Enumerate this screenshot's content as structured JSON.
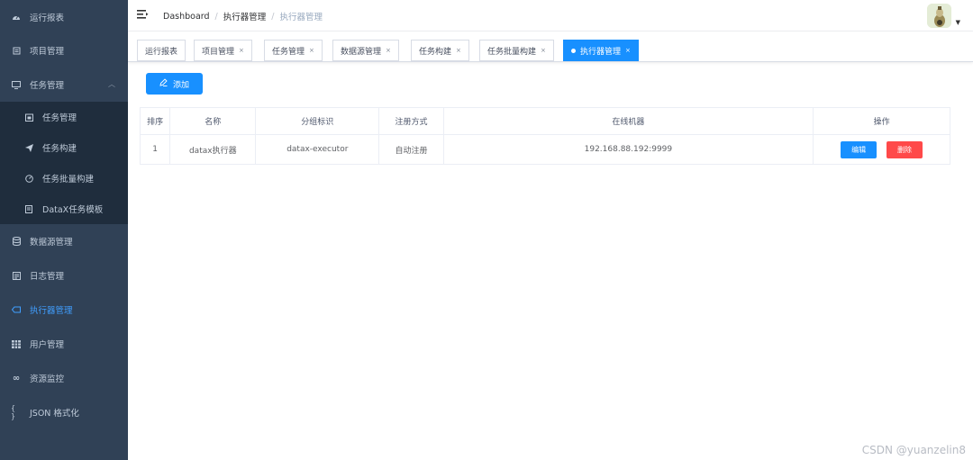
{
  "sidebar": {
    "items": [
      {
        "label": "运行报表",
        "icon": "dashboard-icon"
      },
      {
        "label": "项目管理",
        "icon": "project-icon"
      },
      {
        "label": "任务管理",
        "icon": "monitor-icon"
      },
      {
        "label": "数据源管理",
        "icon": "database-icon"
      },
      {
        "label": "日志管理",
        "icon": "log-icon"
      },
      {
        "label": "执行器管理",
        "icon": "executor-icon"
      },
      {
        "label": "用户管理",
        "icon": "table-icon"
      },
      {
        "label": "资源监控",
        "icon": "infinity-icon"
      },
      {
        "label": "JSON 格式化",
        "icon": "braces-icon"
      }
    ],
    "submenu": [
      {
        "label": "任务管理"
      },
      {
        "label": "任务构建"
      },
      {
        "label": "任务批量构建"
      },
      {
        "label": "DataX任务模板"
      }
    ]
  },
  "breadcrumb": [
    "Dashboard",
    "执行器管理",
    "执行器管理"
  ],
  "tags": [
    {
      "label": "运行报表"
    },
    {
      "label": "项目管理"
    },
    {
      "label": "任务管理"
    },
    {
      "label": "数据源管理"
    },
    {
      "label": "任务构建"
    },
    {
      "label": "任务批量构建"
    },
    {
      "label": "执行器管理"
    }
  ],
  "toolbar": {
    "add_label": "添加"
  },
  "table": {
    "headers": [
      "排序",
      "名称",
      "分组标识",
      "注册方式",
      "在线机器",
      "操作"
    ],
    "rows": [
      {
        "order": "1",
        "name": "datax执行器",
        "group": "datax-executor",
        "reg": "自动注册",
        "machines": "192.168.88.192:9999",
        "edit": "编辑",
        "delete": "删除"
      }
    ]
  },
  "watermark": "CSDN @yuanzelin8",
  "colors": {
    "sidebar_bg": "#304156",
    "submenu_bg": "#1f2d3d",
    "primary": "#1890ff",
    "danger": "#ff4949",
    "active_menu": "#409eff"
  }
}
